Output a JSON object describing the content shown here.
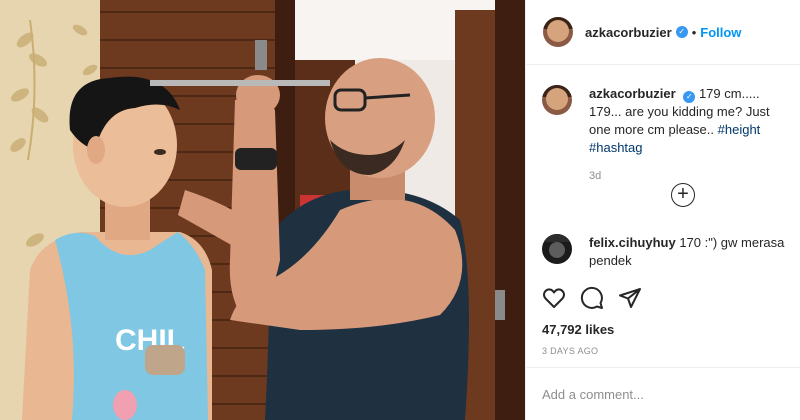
{
  "post": {
    "author": "azkacorbuzier",
    "follow_label": "Follow",
    "separator": "•",
    "caption": {
      "username": "azkacorbuzier",
      "text_before": "179 cm..... 179... are you kidding me? Just one more cm please..",
      "hashtags": [
        "#height",
        "#hashtag"
      ],
      "time": "3d"
    },
    "comments": [
      {
        "username": "felix.cihuyhuy",
        "text": "170 :\") gw merasa pendek"
      }
    ],
    "likes": "47,792 likes",
    "date": "3 DAYS AGO",
    "comment_placeholder": "Add a comment...",
    "photo_shirt_text": "CHIL",
    "icons": {
      "verified": "verified-badge-icon",
      "load_more": "plus-circle-icon",
      "like": "heart-icon",
      "comment": "comment-bubble-icon",
      "share": "paper-plane-icon"
    },
    "colors": {
      "accent": "#0095f6",
      "verified": "#3897f0",
      "hashtag": "#00376b",
      "muted": "#8e8e8e",
      "border": "#efefef"
    }
  }
}
